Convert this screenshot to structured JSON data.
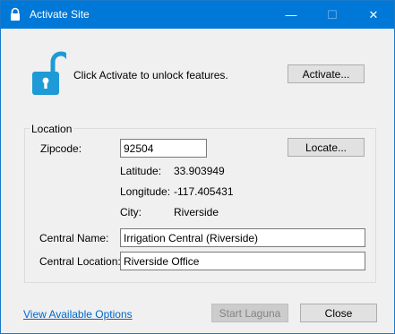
{
  "window": {
    "title": "Activate Site",
    "minimize": "—",
    "maximize": "☐",
    "close": "✕"
  },
  "activation": {
    "message": "Click Activate to unlock features.",
    "activate_label": "Activate..."
  },
  "location": {
    "group_title": "Location",
    "zipcode_label": "Zipcode:",
    "zipcode_value": "92504",
    "locate_label": "Locate...",
    "latitude_label": "Latitude:",
    "latitude_value": "33.903949",
    "longitude_label": "Longitude:",
    "longitude_value": "-117.405431",
    "city_label": "City:",
    "city_value": "Riverside"
  },
  "central": {
    "name_label": "Central Name:",
    "name_value": "Irrigation Central (Riverside)",
    "location_label": "Central Location:",
    "location_value": "Riverside Office"
  },
  "footer": {
    "options_link": "View Available Options",
    "start_label": "Start Laguna",
    "close_label": "Close"
  },
  "colors": {
    "titlebar": "#0078d7",
    "lock": "#1e9ad6",
    "link": "#0066cc"
  }
}
